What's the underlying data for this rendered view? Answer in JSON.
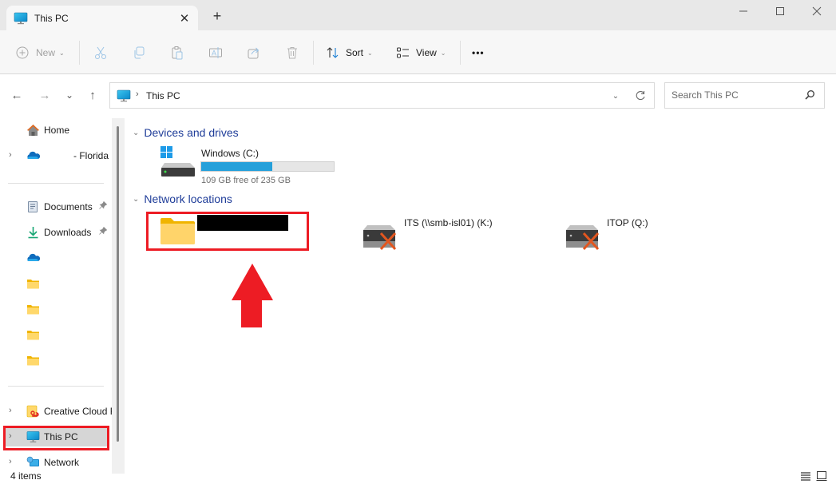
{
  "window": {
    "tab_title": "This PC",
    "new_tab_symbol": "+",
    "close_tab_symbol": "✕",
    "controls": {
      "minimize": "—",
      "maximize": "☐",
      "close": "✕"
    }
  },
  "toolbar": {
    "new_label": "New",
    "sort_label": "Sort",
    "view_label": "View",
    "more_label": "•••",
    "icons": [
      "plus-circle-icon",
      "cut-icon",
      "copy-icon",
      "paste-icon",
      "rename-icon",
      "share-icon",
      "delete-icon",
      "sort-icon",
      "view-icon",
      "more-icon"
    ]
  },
  "navigation": {
    "back": "←",
    "forward": "→",
    "recent": "⌄",
    "up": "↑"
  },
  "address": {
    "crumb_separator": "›",
    "crumbs": [
      "This PC"
    ],
    "dropdown": "⌄"
  },
  "search": {
    "placeholder": "Search This PC",
    "value": ""
  },
  "sidebar": {
    "items": [
      {
        "label": "Home",
        "icon": "home-icon",
        "expandable": false,
        "pinned": false
      },
      {
        "label": "- Florida S",
        "icon": "onedrive-icon",
        "expandable": true,
        "pinned": false
      },
      {
        "label": "Documents",
        "icon": "documents-icon",
        "expandable": false,
        "pinned": true
      },
      {
        "label": "Downloads",
        "icon": "downloads-icon",
        "expandable": false,
        "pinned": true
      },
      {
        "label": "",
        "icon": "onedrive-icon",
        "expandable": false,
        "pinned": false
      },
      {
        "label": "",
        "icon": "folder-icon",
        "expandable": false,
        "pinned": false
      },
      {
        "label": "",
        "icon": "folder-icon",
        "expandable": false,
        "pinned": false
      },
      {
        "label": "",
        "icon": "folder-icon",
        "expandable": false,
        "pinned": false
      },
      {
        "label": "",
        "icon": "folder-icon",
        "expandable": false,
        "pinned": false
      },
      {
        "label": "Creative Cloud F",
        "icon": "creative-cloud-icon",
        "expandable": true,
        "pinned": false
      },
      {
        "label": "This PC",
        "icon": "this-pc-icon",
        "expandable": true,
        "pinned": false,
        "selected": true
      },
      {
        "label": "Network",
        "icon": "network-icon",
        "expandable": true,
        "pinned": false
      }
    ],
    "pin_symbol": "📌",
    "expander_symbol": "›"
  },
  "content": {
    "groups": [
      {
        "title": "Devices and drives",
        "items": [
          {
            "name": "Windows (C:)",
            "free_text": "109 GB free of 235 GB",
            "free_gb": 109,
            "total_gb": 235,
            "used_fraction": 0.536
          }
        ]
      },
      {
        "title": "Network locations",
        "items": [
          {
            "name": "[redacted]",
            "icon": "folder-icon",
            "highlighted": true
          },
          {
            "name": "ITS (\\\\smb-isl01) (K:)",
            "icon": "disconnected-network-drive-icon"
          },
          {
            "name": "ITOP (Q:)",
            "icon": "disconnected-network-drive-icon"
          }
        ]
      }
    ],
    "group_chevron": "⌄"
  },
  "annotations": {
    "arrow_color": "#ed1c24",
    "highlight_color": "#ed1c24"
  },
  "statusbar": {
    "item_count": "4 items"
  },
  "colors": {
    "accent_blue": "#26a0da",
    "group_header": "#1f3d99",
    "selected_bg": "#d6d6d6"
  }
}
